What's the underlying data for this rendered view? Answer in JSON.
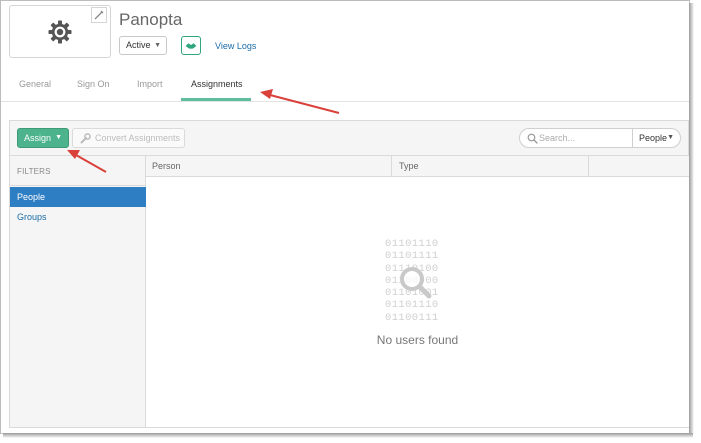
{
  "app": {
    "name": "Panopta",
    "status": "Active",
    "view_logs_label": "View Logs"
  },
  "tabs": [
    {
      "label": "General"
    },
    {
      "label": "Sign On"
    },
    {
      "label": "Import"
    },
    {
      "label": "Assignments"
    }
  ],
  "active_tab": "Assignments",
  "toolbar": {
    "assign_label": "Assign",
    "convert_label": "Convert Assignments",
    "search_placeholder": "Search...",
    "people_select": "People"
  },
  "sidebar": {
    "heading": "FILTERS",
    "items": [
      {
        "label": "People",
        "selected": true
      },
      {
        "label": "Groups",
        "selected": false
      }
    ]
  },
  "table": {
    "columns": [
      "Person",
      "Type"
    ],
    "binary_lines": [
      "01101110",
      "01101111",
      "01110100",
      "01100000",
      "01101001",
      "01101110",
      "01100111"
    ],
    "empty_message": "No users found"
  },
  "colors": {
    "accent_green": "#4cb38c",
    "selected_blue": "#2e7ec3",
    "link_blue": "#1b6ca8",
    "annotation_red": "#d9413a"
  }
}
